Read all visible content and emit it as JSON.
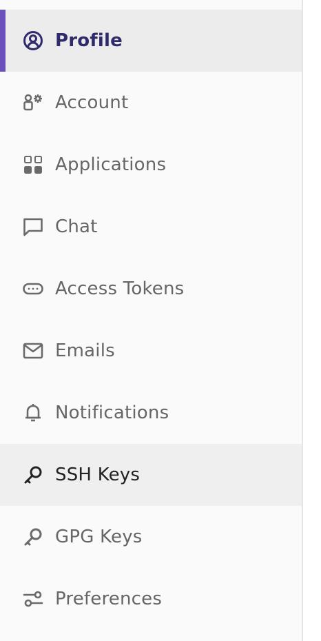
{
  "nav": {
    "items": [
      {
        "label": "Profile",
        "icon": "profile-icon"
      },
      {
        "label": "Account",
        "icon": "account-icon"
      },
      {
        "label": "Applications",
        "icon": "applications-icon"
      },
      {
        "label": "Chat",
        "icon": "chat-icon"
      },
      {
        "label": "Access Tokens",
        "icon": "token-icon"
      },
      {
        "label": "Emails",
        "icon": "mail-icon"
      },
      {
        "label": "Notifications",
        "icon": "bell-icon"
      },
      {
        "label": "SSH Keys",
        "icon": "key-icon"
      },
      {
        "label": "GPG Keys",
        "icon": "key-icon"
      },
      {
        "label": "Preferences",
        "icon": "preferences-icon"
      }
    ],
    "active_item": "Profile",
    "highlighted_item": "SSH Keys"
  },
  "colors": {
    "accent": "#6b4fbb",
    "active_text": "#2f2a6b",
    "text": "#666666",
    "background": "#fafafa",
    "active_background": "#ececec"
  }
}
